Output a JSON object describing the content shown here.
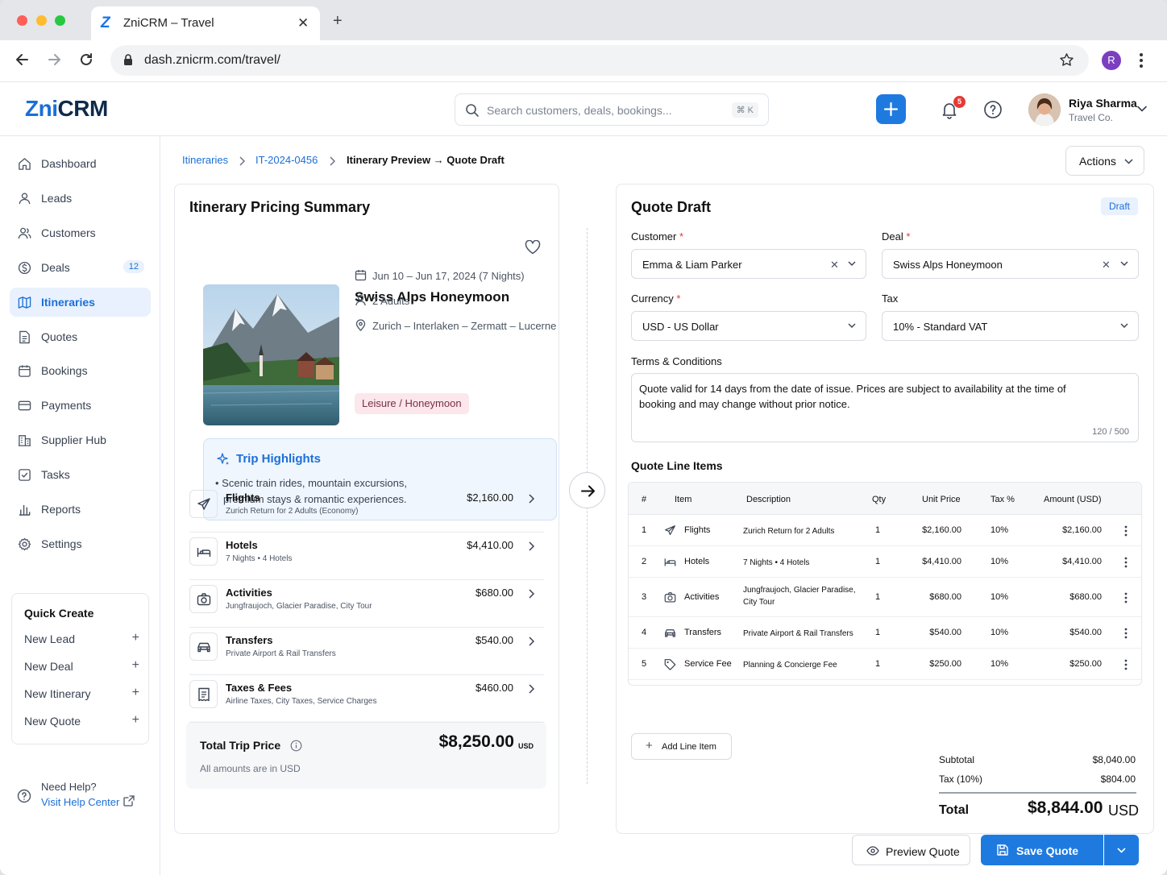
{
  "browser": {
    "tab_title": "ZniCRM – Travel",
    "url": "dash.znicrm.com/travel/",
    "profile_initial": "R",
    "favicon_letter": "Z"
  },
  "header": {
    "brand_prefix": "Zni",
    "brand_suffix": "CRM",
    "search_placeholder": "Search customers, deals, bookings...",
    "search_shortcut": "⌘ K",
    "notification_count": "5",
    "user_name": "Riya Sharma",
    "user_org": "Travel Co."
  },
  "sidebar": {
    "items": [
      {
        "label": "Dashboard",
        "icon": "home-icon"
      },
      {
        "label": "Leads",
        "icon": "user-icon"
      },
      {
        "label": "Customers",
        "icon": "users-icon"
      },
      {
        "label": "Deals",
        "icon": "dollar-icon",
        "count": "12"
      },
      {
        "label": "Itineraries",
        "icon": "map-icon",
        "active": true
      },
      {
        "label": "Quotes",
        "icon": "document-icon"
      },
      {
        "label": "Bookings",
        "icon": "calendar-icon"
      },
      {
        "label": "Payments",
        "icon": "card-icon"
      },
      {
        "label": "Supplier Hub",
        "icon": "building-icon"
      },
      {
        "label": "Tasks",
        "icon": "checkbox-icon"
      },
      {
        "label": "Reports",
        "icon": "bar-chart-icon"
      },
      {
        "label": "Settings",
        "icon": "gear-icon"
      }
    ],
    "quick_create": {
      "title": "Quick Create",
      "items": [
        "New Lead",
        "New Deal",
        "New Itinerary",
        "New Quote"
      ]
    },
    "help": {
      "title": "Need Help?",
      "link": "Visit Help Center"
    }
  },
  "breadcrumb": {
    "items": [
      "Itineraries",
      "IT-2024-0456",
      "Itinerary Preview → Quote Draft"
    ],
    "actions_label": "Actions"
  },
  "summary": {
    "title": "Itinerary Pricing Summary",
    "trip_name": "Swiss Alps Honeymoon",
    "dates": "Jun 10 – Jun 17, 2024 (7 Nights)",
    "travellers": "2 Adults",
    "route": "Zurich – Interlaken – Zermatt – Lucerne",
    "tag": "Leisure / Honeymoon",
    "highlights_title": "Trip Highlights",
    "highlights_text_1": "• Scenic train rides, mountain excursions,",
    "highlights_text_2": "premium stays & romantic experiences.",
    "lines": [
      {
        "name": "Flights",
        "desc": "Zurich Return for 2 Adults (Economy)",
        "amount": "$2,160.00",
        "icon": "plane-icon"
      },
      {
        "name": "Hotels",
        "desc": "7 Nights • 4 Hotels",
        "amount": "$4,410.00",
        "icon": "bed-icon"
      },
      {
        "name": "Activities",
        "desc": "Jungfraujoch, Glacier Paradise, City Tour",
        "amount": "$680.00",
        "icon": "camera-icon"
      },
      {
        "name": "Transfers",
        "desc": "Private Airport & Rail Transfers",
        "amount": "$540.00",
        "icon": "car-icon"
      },
      {
        "name": "Taxes & Fees",
        "desc": "Airline Taxes, City Taxes, Service Charges",
        "amount": "$460.00",
        "icon": "receipt-icon"
      }
    ],
    "total_label": "Total Trip Price",
    "total_value": "$8,250.00",
    "total_currency": "USD",
    "total_note": "All amounts are in USD"
  },
  "quote": {
    "title": "Quote Draft",
    "status": "Draft",
    "customer_label": "Customer",
    "customer_value": "Emma & Liam Parker",
    "deal_label": "Deal",
    "deal_value": "Swiss Alps Honeymoon",
    "currency_label": "Currency",
    "currency_value": "USD - US Dollar",
    "tax_label": "Tax",
    "tax_value": "10% - Standard VAT",
    "required_mark": "*",
    "terms_label": "Terms & Conditions",
    "terms_text": "Quote valid for 14 days from the date of issue. Prices are subject to availability at the time of booking and may change without prior notice.",
    "terms_count": "120 / 500",
    "line_items_title": "Quote Line Items",
    "table_headers": [
      "#",
      "Item",
      "Description",
      "Qty",
      "Unit Price",
      "Tax %",
      "Amount (USD)"
    ],
    "rows": [
      {
        "num": "1",
        "item": "Flights",
        "icon": "plane-icon",
        "desc": "Zurich Return for 2 Adults",
        "qty": "1",
        "unit": "$2,160.00",
        "tax": "10%",
        "amount": "$2,160.00"
      },
      {
        "num": "2",
        "item": "Hotels",
        "icon": "bed-icon",
        "desc": "7 Nights • 4 Hotels",
        "qty": "1",
        "unit": "$4,410.00",
        "tax": "10%",
        "amount": "$4,410.00"
      },
      {
        "num": "3",
        "item": "Activities",
        "icon": "camera-icon",
        "desc": "Jungfraujoch, Glacier Paradise, City Tour",
        "qty": "1",
        "unit": "$680.00",
        "tax": "10%",
        "amount": "$680.00"
      },
      {
        "num": "4",
        "item": "Transfers",
        "icon": "car-icon",
        "desc": "Private Airport & Rail Transfers",
        "qty": "1",
        "unit": "$540.00",
        "tax": "10%",
        "amount": "$540.00"
      },
      {
        "num": "5",
        "item": "Service Fee",
        "icon": "tag-icon",
        "desc": "Planning & Concierge Fee",
        "qty": "1",
        "unit": "$250.00",
        "tax": "10%",
        "amount": "$250.00"
      }
    ],
    "add_line_label": "Add Line Item",
    "subtotal_label": "Subtotal",
    "subtotal_value": "$8,040.00",
    "tax_sum_label": "Tax (10%)",
    "tax_sum_value": "$804.00",
    "grand_label": "Total",
    "grand_value": "$8,844.00",
    "grand_currency": "USD",
    "preview_label": "Preview Quote",
    "save_label": "Save Quote"
  },
  "colors": {
    "accent": "#1f7ae0",
    "brand_dark": "#0f2a4a",
    "tag_bg": "#fbe7ec",
    "badge_red": "#e53935"
  }
}
